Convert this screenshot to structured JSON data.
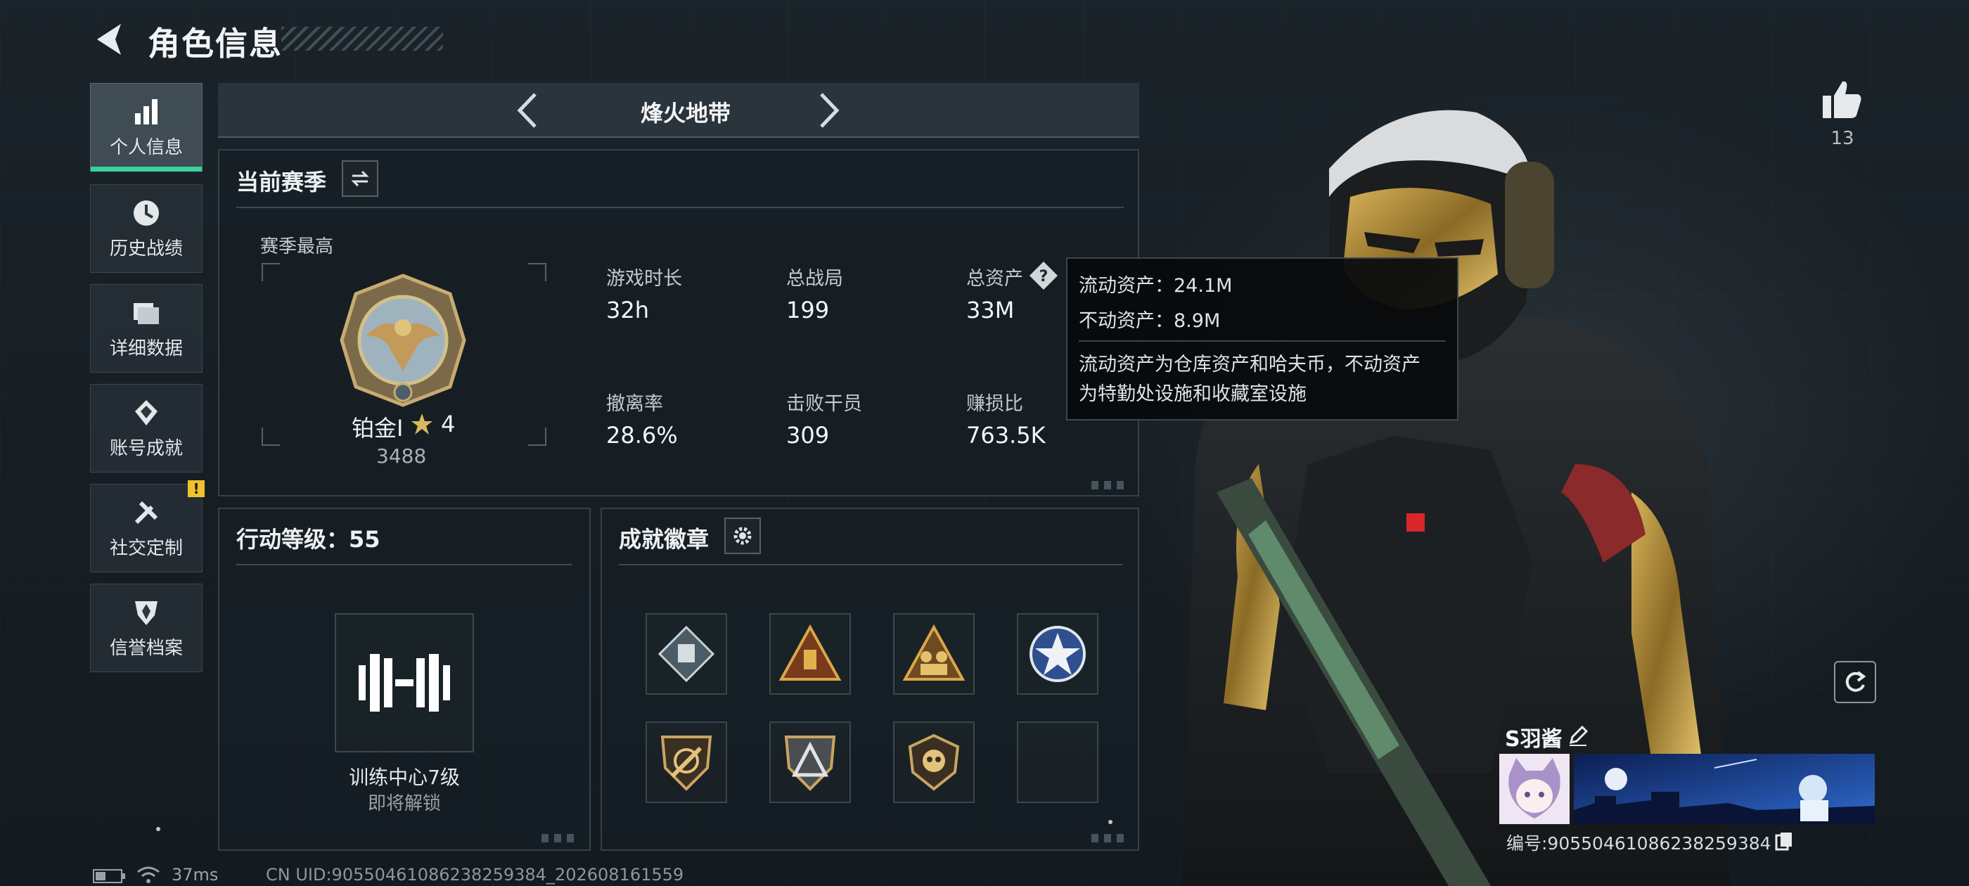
{
  "header": {
    "title": "角色信息"
  },
  "sidebar": {
    "items": [
      {
        "label": "个人信息",
        "icon": "bar-chart-icon",
        "active": true
      },
      {
        "label": "历史战绩",
        "icon": "history-icon"
      },
      {
        "label": "详细数据",
        "icon": "folder-icon"
      },
      {
        "label": "账号成就",
        "icon": "achievement-icon"
      },
      {
        "label": "社交定制",
        "icon": "tools-icon",
        "badge": "!"
      },
      {
        "label": "信誉档案",
        "icon": "shield-icon"
      }
    ]
  },
  "mode": {
    "label": "烽火地带"
  },
  "season": {
    "title": "当前赛季",
    "best_label": "赛季最高",
    "rank_name": "铂金Ⅰ",
    "rank_stars": "4",
    "rank_score": "3488",
    "stats": [
      {
        "label": "游戏时长",
        "value": "32h"
      },
      {
        "label": "总战局",
        "value": "199"
      },
      {
        "label": "总资产",
        "value": "33M"
      },
      {
        "label": "撤离率",
        "value": "28.6%"
      },
      {
        "label": "击败干员",
        "value": "309"
      },
      {
        "label": "赚损比",
        "value": "763.5K"
      }
    ]
  },
  "tooltip": {
    "liquid": "流动资产：24.1M",
    "fixed": "不动资产：8.9M",
    "desc_line1": "流动资产为仓库资产和哈夫币，不动资产",
    "desc_line2": "为特勤处设施和收藏室设施"
  },
  "level": {
    "title": "行动等级：55",
    "training_name": "训练中心7级",
    "training_status": "即将解锁"
  },
  "badges": {
    "title": "成就徽章",
    "items": [
      "diamond-badge",
      "gold-triangle-badge",
      "squad-badge",
      "star-emblem-badge",
      "crossed-shield-badge",
      "triangle-badge",
      "skull-badge",
      "empty-slot"
    ]
  },
  "profile": {
    "likes": "13",
    "nickname": "S羽酱",
    "player_id": "编号:9055046108623825938​4"
  },
  "footer": {
    "ping": "37ms",
    "uid": "CN UID:9055046108623825938​4_202608161559"
  },
  "colors": {
    "accent": "#36d39a",
    "warning": "#f0c12c",
    "bronze": "#c39a5a"
  }
}
